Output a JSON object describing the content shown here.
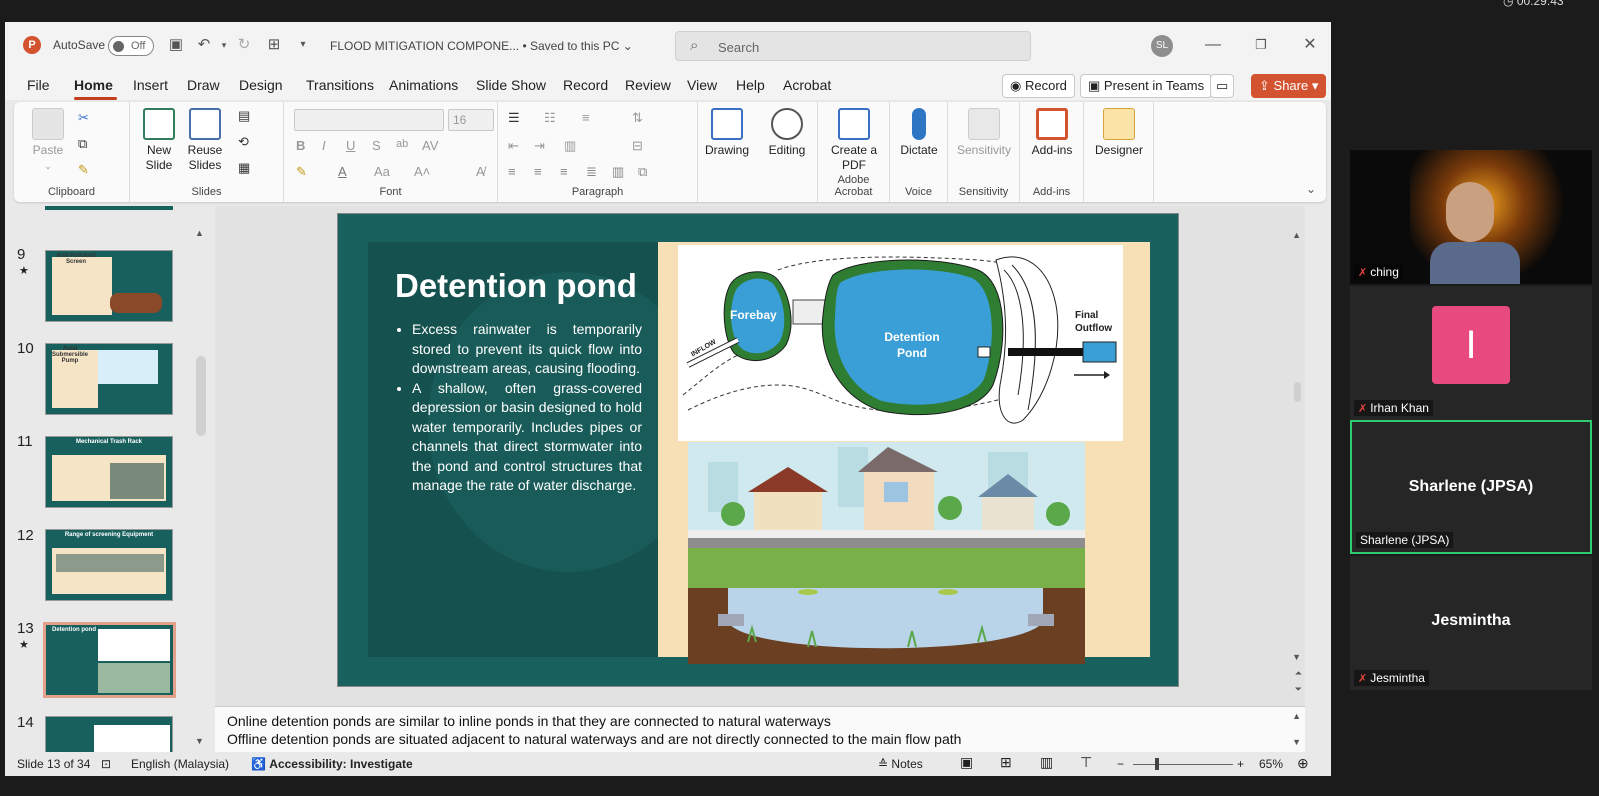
{
  "titlebar": {
    "autosave_label": "AutoSave",
    "autosave_state": "Off",
    "doc_title": "FLOOD MITIGATION COMPONE... • Saved to this PC",
    "search_placeholder": "Search",
    "user_initials": "SL"
  },
  "menu": {
    "tabs": [
      "File",
      "Home",
      "Insert",
      "Draw",
      "Design",
      "Transitions",
      "Animations",
      "Slide Show",
      "Record",
      "Review",
      "View",
      "Help",
      "Acrobat"
    ],
    "active_tab": "Home",
    "record_btn": "Record",
    "present_btn": "Present in Teams",
    "share_btn": "Share"
  },
  "ribbon": {
    "clipboard": {
      "label": "Clipboard",
      "paste": "Paste"
    },
    "slides": {
      "label": "Slides",
      "new_slide": "New Slide",
      "reuse_slides": "Reuse Slides"
    },
    "font": {
      "label": "Font",
      "size_value": "16"
    },
    "paragraph": {
      "label": "Paragraph"
    },
    "drawing": {
      "label": "Drawing"
    },
    "editing": {
      "label": "Editing"
    },
    "acrobat": {
      "label": "Adobe Acrobat",
      "create_pdf": "Create a PDF"
    },
    "voice": {
      "label": "Voice",
      "dictate": "Dictate"
    },
    "sensitivity": {
      "label": "Sensitivity",
      "btn": "Sensitivity"
    },
    "addins": {
      "label": "Add-ins",
      "btn": "Add-ins"
    },
    "designer": {
      "btn": "Designer"
    }
  },
  "thumbnails": [
    {
      "num": "9",
      "starred": true,
      "title": "Anti-Pollutant Screen"
    },
    {
      "num": "10",
      "starred": false,
      "title": "Axial Submersible Pump"
    },
    {
      "num": "11",
      "starred": false,
      "title": "Mechanical Trash Rack"
    },
    {
      "num": "12",
      "starred": false,
      "title": "Range of screening Equipment"
    },
    {
      "num": "13",
      "starred": true,
      "title": "Detention pond",
      "selected": true
    },
    {
      "num": "14",
      "starred": false,
      "title": ""
    }
  ],
  "slide": {
    "title": "Detention pond",
    "bullets": [
      "Excess rainwater is temporarily stored to prevent its quick flow into downstream areas, causing flooding.",
      "A shallow, often grass-covered depression or basin designed to hold water temporarily. Includes pipes or channels that direct stormwater into the pond and control structures that manage the rate of water discharge."
    ],
    "diagram": {
      "forebay": "Forebay",
      "inflow": "INFLOW",
      "pond_line1": "Detention",
      "pond_line2": "Pond",
      "outflow_line1": "Final",
      "outflow_line2": "Outflow"
    }
  },
  "notes": {
    "line1": "Online detention ponds are similar to inline ponds in that they are connected to natural waterways",
    "line2": "Offline detention ponds are situated adjacent to natural waterways and are not directly connected to the main flow path"
  },
  "status": {
    "slide_info": "Slide 13 of 34",
    "language": "English (Malaysia)",
    "accessibility": "Accessibility: Investigate",
    "notes": "Notes",
    "zoom": "65%"
  },
  "meeting": {
    "timer": "00:29:43",
    "participants": [
      {
        "name": "ching",
        "muted": true,
        "video": true
      },
      {
        "name": "Irhan Khan",
        "muted": true,
        "initial": "I"
      },
      {
        "name": "Sharlene (JPSA)",
        "muted": false,
        "active": true
      },
      {
        "name": "Jesmintha",
        "muted": true
      }
    ]
  },
  "colors": {
    "accent": "#c43e1c",
    "slide_teal": "#18615e",
    "share": "#d35230",
    "active_speaker": "#2ecc71",
    "irhan_avatar": "#e84a7f"
  }
}
